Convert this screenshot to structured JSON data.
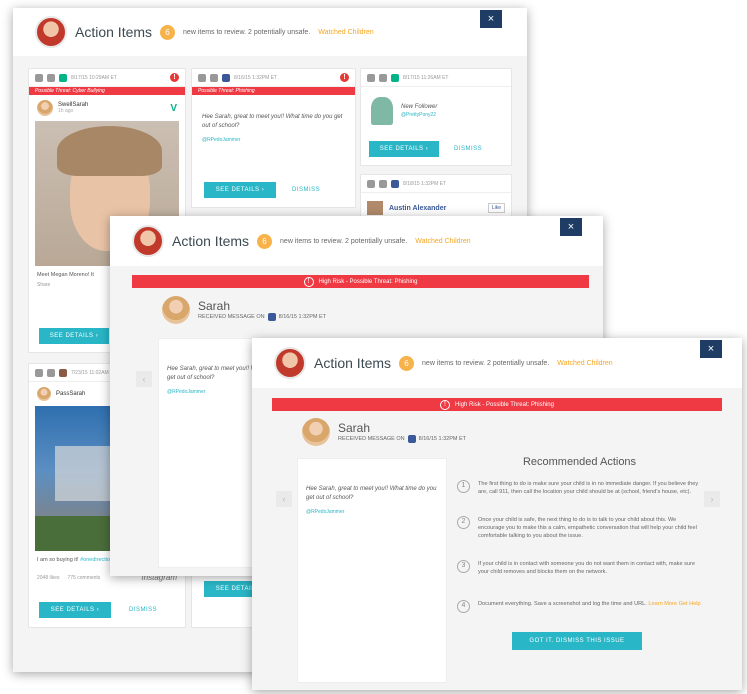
{
  "header": {
    "title": "Action Items",
    "badge_count": "6",
    "subtitle": "new items to review. 2 potentially unsafe.",
    "link": "Watched Children",
    "close": "×"
  },
  "back_window": {
    "cards": [
      {
        "timestamp": "8/17/15 10:29AM ET",
        "threat": "Possible Threat: Cyber Bullying",
        "user": "SwellSarah",
        "time_ago": "1h ago",
        "caption": "Meet Megan Moreno! It",
        "share": "Share",
        "see_details": "SEE DETAILS ›"
      },
      {
        "timestamp": "8/16/15 1:32PM ET",
        "threat": "Possible Threat: Phishing",
        "message": "Hee Sarah, great to meet you!! What time do you get out of school?",
        "handle": "@RPedoJammer",
        "see_details": "SEE DETAILS ›",
        "dismiss": "DISMISS"
      },
      {
        "timestamp": "8/17/15 11:26AM ET",
        "label": "New Follower",
        "handle": "@PrettyPony22",
        "see_details": "SEE DETAILS ›",
        "dismiss": "DISMISS"
      },
      {
        "timestamp": "8/18/15 1:32PM ET",
        "name": "Austin Alexander",
        "like": "Like"
      },
      {
        "timestamp": "7/23/15 11:02AM ET",
        "user": "PassSarah",
        "caption": "I am so buying it!",
        "hashtag": "#onedirection",
        "likes": "2048 likes",
        "comments": "775 comments",
        "network": "Instagram",
        "see_details": "SEE DETAILS ›",
        "dismiss": "DISMISS"
      }
    ]
  },
  "threat_bar": "High Risk - Possible Threat: Phishing",
  "detail": {
    "name": "Sarah",
    "received": "RECEIVED MESSAGE ON",
    "date": "8/16/15 1:32PM ET",
    "message": "Hee Sarah, great to meet you!! What time do you get out of school?",
    "handle": "@RPedoJammer"
  },
  "recommended": {
    "title": "Recommended Actions",
    "steps": [
      {
        "num": "1",
        "text": "The first thing to do is make sure your child is in no immediate danger.  If you believe they are, call 911, then call the location your child should be at (school, friend's house, etc)."
      },
      {
        "num": "2",
        "text": "Once your child is safe, the next thing to do is to talk to your child about this.  We encourage you to make this a calm, empathetic conversation that will help your child feel comfortable talking to you about the issue."
      },
      {
        "num": "3",
        "text": "If your child is in contact with someone you do not want them in contact with, make sure your child removes and blocks them on the network."
      },
      {
        "num": "4",
        "text": "Document everything.  Save a screenshot and log the time and URL.",
        "link1": "Learn More",
        "link2": "Get Help"
      }
    ],
    "button": "GOT IT.  DISMISS THIS ISSUE"
  },
  "nav": {
    "prev": "‹",
    "next": "›"
  },
  "colors": {
    "accent": "#29b6c6",
    "alert": "#ef3a44",
    "navy": "#1f3d64",
    "orange": "#f7b24a"
  }
}
